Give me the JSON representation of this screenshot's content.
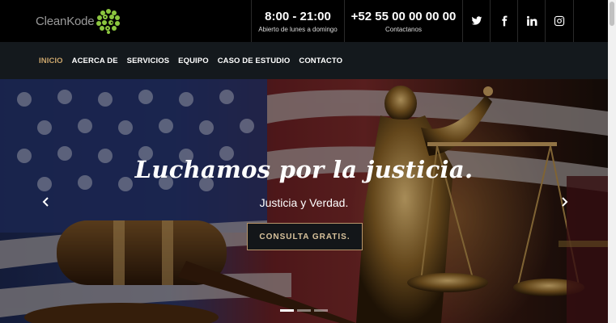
{
  "brand": {
    "name": "CleanKode"
  },
  "topbar": {
    "hours": {
      "value": "8:00 - 21:00",
      "caption": "Abierto de lunes a domingo"
    },
    "phone": {
      "value": "+52 55 00 00 00 00",
      "caption": "Contactanos"
    },
    "social": [
      "twitter-icon",
      "facebook-icon",
      "linkedin-icon",
      "instagram-icon"
    ]
  },
  "nav": {
    "items": [
      {
        "label": "INICIO",
        "active": true
      },
      {
        "label": "ACERCA DE"
      },
      {
        "label": "SERVICIOS"
      },
      {
        "label": "EQUIPO"
      },
      {
        "label": "CASO DE ESTUDIO"
      },
      {
        "label": "CONTACTO"
      }
    ]
  },
  "hero": {
    "title": "Luchamos por la justicia.",
    "subtitle": "Justicia y Verdad.",
    "cta_label": "CONSULTA GRATIS.",
    "slides": 3,
    "active_slide": 1
  },
  "colors": {
    "accent": "#c9a46b",
    "nav_bg": "#14191d",
    "topbar_bg": "#000000"
  }
}
